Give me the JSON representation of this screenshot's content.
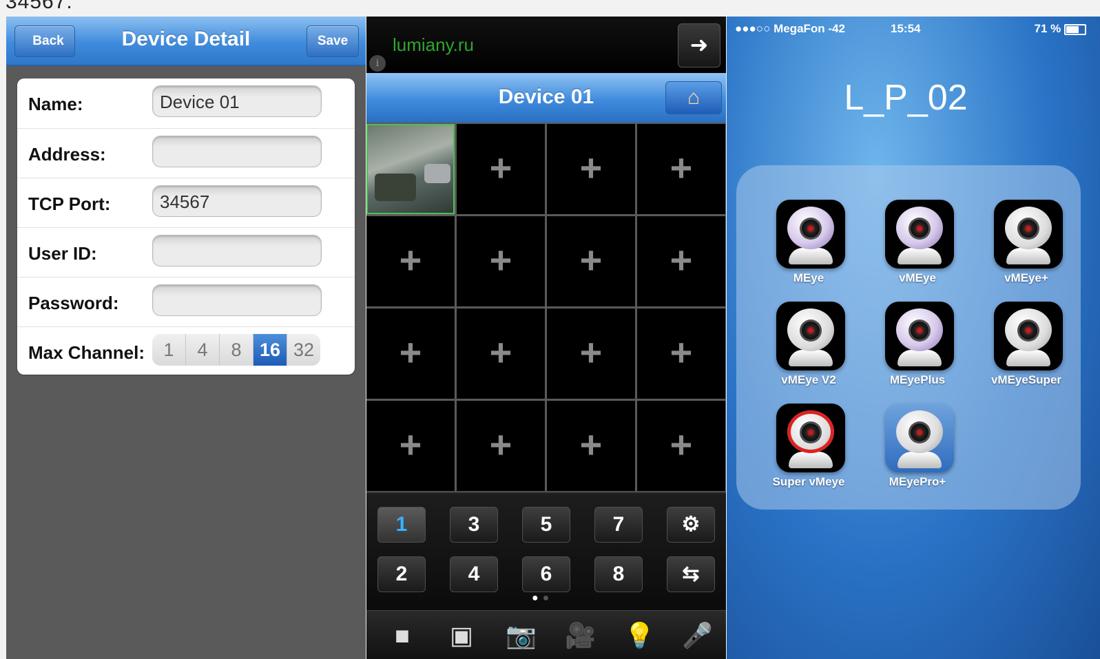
{
  "top_crop_text": "34567.",
  "device_detail": {
    "title": "Device Detail",
    "back_label": "Back",
    "save_label": "Save",
    "fields": [
      {
        "label": "Name:",
        "value": "Device 01"
      },
      {
        "label": "Address:",
        "value": ""
      },
      {
        "label": "TCP Port:",
        "value": "34567"
      },
      {
        "label": "User ID:",
        "value": ""
      },
      {
        "label": "Password:",
        "value": ""
      }
    ],
    "max_channel": {
      "label": "Max Channel:",
      "options": [
        "1",
        "4",
        "8",
        "16",
        "32"
      ],
      "selected": "16"
    }
  },
  "viewer": {
    "site": "lumiany.ru",
    "info_icon": "i",
    "arrow_icon": "➜",
    "title": "Device 01",
    "home_icon": "⌂",
    "cell_icon": "+",
    "keys_top": [
      "1",
      "3",
      "5",
      "7",
      "⚙"
    ],
    "keys_bottom": [
      "2",
      "4",
      "6",
      "8",
      "⇆"
    ],
    "selected_key": "1",
    "toolbar_icons": [
      "stop-icon",
      "close-view-icon",
      "camera-icon",
      "record-icon",
      "light-icon",
      "microphone-icon"
    ],
    "toolbar_glyphs": [
      "■",
      "▣",
      "📷",
      "🎥",
      "💡",
      "🎤"
    ]
  },
  "home": {
    "carrier": "●●●○○ MegaFon -42",
    "time": "15:54",
    "battery": "71 %",
    "folder_title": "L_P_02",
    "apps": [
      {
        "label": "MEye",
        "style": "purple"
      },
      {
        "label": "vMEye",
        "style": "purple"
      },
      {
        "label": "vMEye+",
        "style": "white"
      },
      {
        "label": "vMEye V2",
        "style": "white"
      },
      {
        "label": "MEyePlus",
        "style": "purple"
      },
      {
        "label": "vMEyeSuper",
        "style": "white"
      },
      {
        "label": "Super vMeye",
        "style": "red"
      },
      {
        "label": "MEyePro+",
        "style": "blue"
      }
    ]
  }
}
